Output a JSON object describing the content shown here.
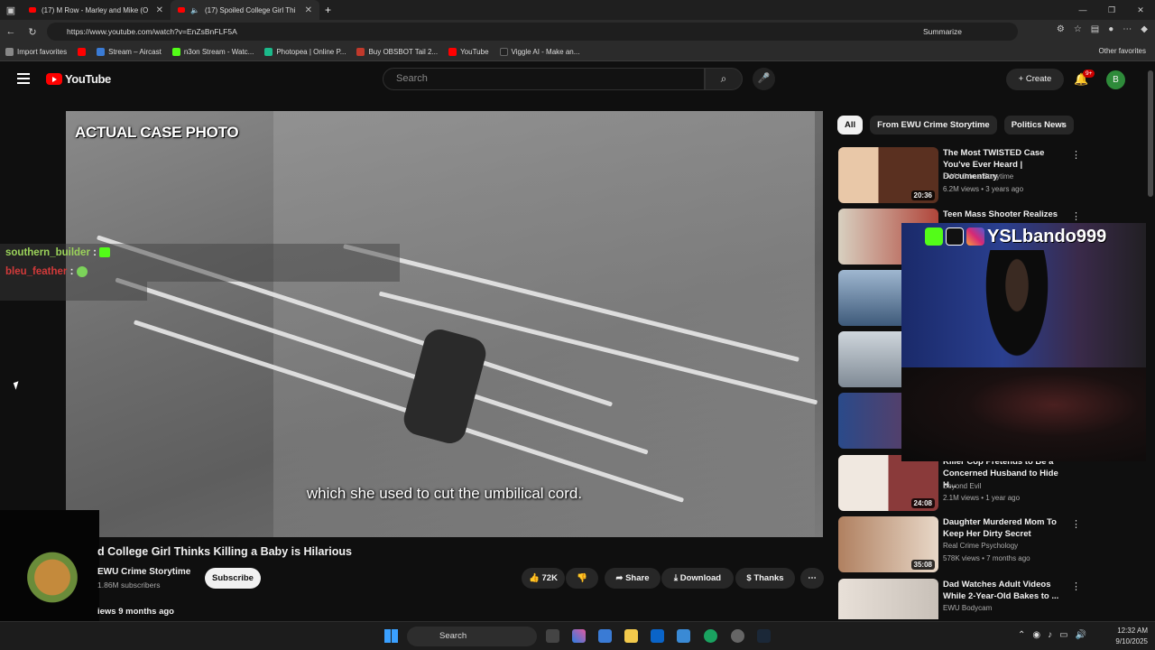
{
  "browser": {
    "tabs": [
      {
        "title": "(17) M Row - Marley and Mike (O",
        "close": "✕"
      },
      {
        "title": "(17) Spoiled College Girl Thi",
        "close": "✕"
      }
    ],
    "new_tab": "+",
    "url": "https://www.youtube.com/watch?v=EnZsBnFLF5A",
    "summarize": "Summarize",
    "bookmarks": [
      {
        "label": "Import favorites",
        "color": "#888888"
      },
      {
        "label": "",
        "color": "#ff0000"
      },
      {
        "label": "Stream – Aircast",
        "color": "#3a7bd5"
      },
      {
        "label": "n3on Stream - Watc...",
        "color": "#53fc18"
      },
      {
        "label": "Photopea | Online P...",
        "color": "#1bb98a"
      },
      {
        "label": "Buy OBSBOT Tail 2...",
        "color": "#c0392b"
      },
      {
        "label": "YouTube",
        "color": "#ff0000"
      },
      {
        "label": "Viggle AI - Make an...",
        "color": "#222222"
      }
    ],
    "other_favorites": "Other favorites"
  },
  "youtube": {
    "logo_text": "YouTube",
    "search_placeholder": "Search",
    "create_label": "Create",
    "notifications": "9+",
    "avatar_letter": "B"
  },
  "video": {
    "overlay_title": "ACTUAL CASE PHOTO",
    "caption": "which she used to cut the umbilical cord.",
    "chat": [
      {
        "user": "southern_builder",
        "sep": ":"
      },
      {
        "user": "bleu_feather",
        "sep": ":"
      }
    ],
    "title": "d College Girl Thinks Killing a Baby is Hilarious",
    "channel": "EWU Crime Storytime",
    "subscribers": "1.86M subscribers",
    "subscribe_label": "Subscribe",
    "likes": "72K",
    "share_label": "Share",
    "download_label": "Download",
    "thanks_label": "Thanks",
    "meta": "iews  9 months ago"
  },
  "chips": [
    "All",
    "From EWU Crime Storytime",
    "Politics News"
  ],
  "recommendations": [
    {
      "title": "The Most TWISTED Case You've Ever Heard | Documentary",
      "channel": "EWU Crime Storytime",
      "meta": "6.2M views • 3 years ago",
      "duration": "20:36",
      "thumb": "#5a3020"
    },
    {
      "title": "Teen Mass Shooter Realizes",
      "channel": "",
      "meta": "",
      "duration": "",
      "thumb": "#b0453a"
    },
    {
      "title": "",
      "channel": "",
      "meta": "",
      "duration": "",
      "thumb": "#3e5a7a"
    },
    {
      "title": "",
      "channel": "",
      "meta": "",
      "duration": "",
      "thumb": "#7f8a95"
    },
    {
      "title": "",
      "channel": "",
      "meta": "",
      "duration": "",
      "thumb": "#2a4a8a"
    },
    {
      "title": "Killer Cop Pretends to Be a Concerned Husband to Hide H...",
      "channel": "Beyond Evil",
      "meta": "2.1M views • 1 year ago",
      "duration": "24:08",
      "thumb": "#8a3a3a"
    },
    {
      "title": "Daughter Murdered Mom To Keep Her Dirty Secret",
      "channel": "Real Crime Psychology",
      "meta": "578K views • 7 months ago",
      "duration": "35:08",
      "thumb": "#b08060"
    },
    {
      "title": "Dad Watches Adult Videos While 2-Year-Old Bakes to ...",
      "channel": "EWU Bodycam",
      "meta": "",
      "duration": "",
      "thumb": "#c8c0b8"
    }
  ],
  "stream_overlay": {
    "handle": "YSLbando999"
  },
  "taskbar": {
    "search": "Search",
    "time": "12:32 AM",
    "date": "9/10/2025"
  }
}
